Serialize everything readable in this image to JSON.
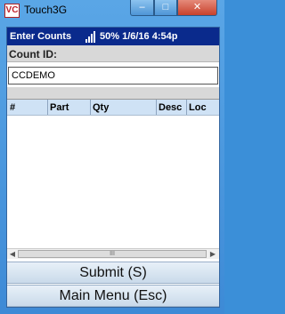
{
  "window": {
    "title": "Touch3G",
    "icon_text": "VC",
    "minimize_glyph": "–",
    "maximize_glyph": "□",
    "close_glyph": "✕"
  },
  "status": {
    "screen_title": "Enter Counts",
    "battery_time": "50% 1/6/16 4:54p"
  },
  "form": {
    "count_label": "Count ID:",
    "count_value": "CCDEMO"
  },
  "grid": {
    "columns": [
      "#",
      "Part",
      "Qty",
      "Desc",
      "Loc"
    ],
    "rows": []
  },
  "scrollbar": {
    "left_arrow": "◀",
    "right_arrow": "▶",
    "thumb_grip": "III"
  },
  "buttons": {
    "submit": "Submit (S)",
    "main_menu": "Main Menu (Esc)"
  }
}
